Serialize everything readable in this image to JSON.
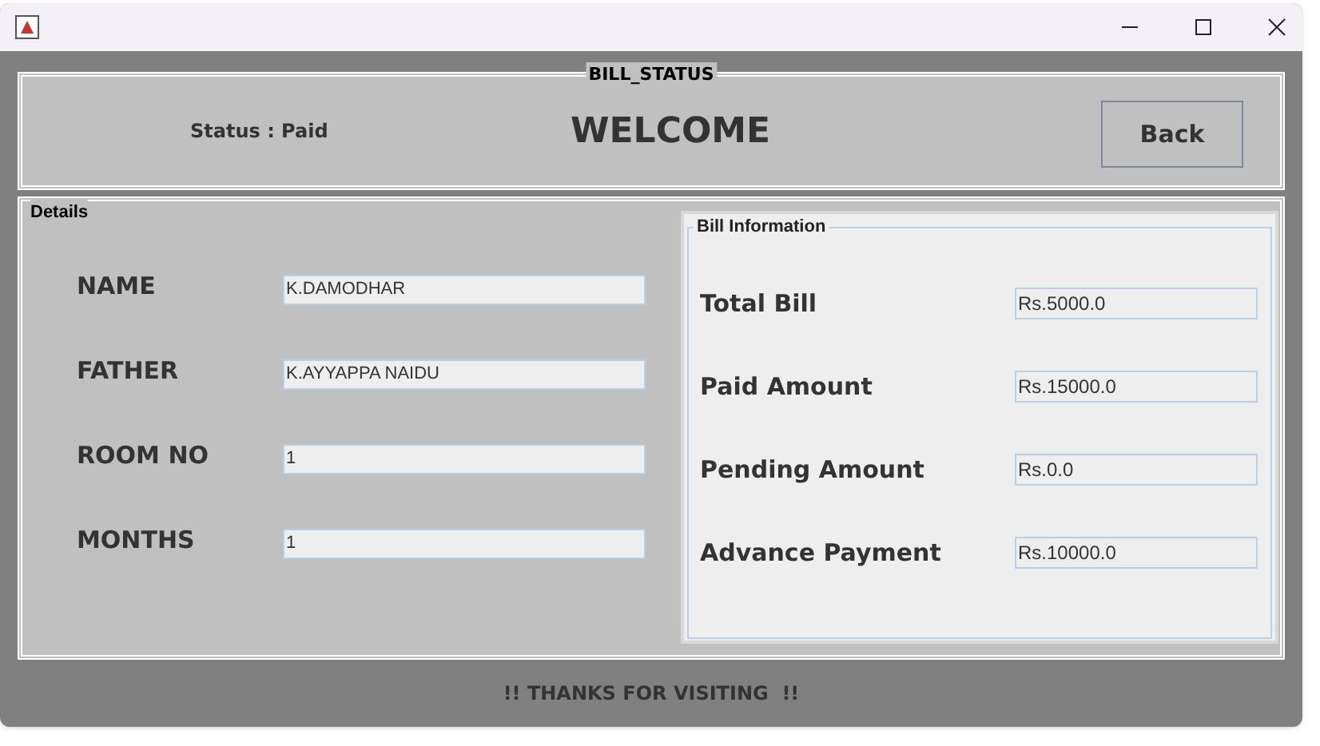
{
  "window": {
    "title": "BILL_STATUS"
  },
  "header": {
    "status": "Status : Paid",
    "heading": "WELCOME",
    "back_button": "Back"
  },
  "details": {
    "title": "Details",
    "fields": [
      {
        "label": "NAME",
        "value": "K.DAMODHAR"
      },
      {
        "label": "FATHER",
        "value": "K.AYYAPPA NAIDU"
      },
      {
        "label": "ROOM NO",
        "value": "1"
      },
      {
        "label": "MONTHS",
        "value": "1"
      }
    ]
  },
  "bill_information": {
    "title": "Bill Information",
    "fields": [
      {
        "label": "Total Bill",
        "value": "Rs.5000.0"
      },
      {
        "label": "Paid Amount",
        "value": "Rs.15000.0"
      },
      {
        "label": "Pending Amount",
        "value": "Rs.0.0"
      },
      {
        "label": "Advance Payment",
        "value": "Rs.10000.0"
      }
    ]
  },
  "footer": "!! THANKS FOR VISITING  !!"
}
